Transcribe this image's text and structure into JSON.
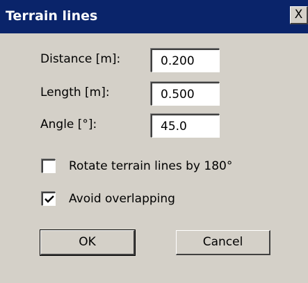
{
  "window": {
    "title": "Terrain lines",
    "close_glyph": "X"
  },
  "fields": {
    "distance": {
      "label": "Distance [m]:",
      "value": "0.200"
    },
    "length": {
      "label": "Length [m]:",
      "value": "0.500"
    },
    "angle": {
      "label": "Angle [°]:",
      "value": "45.0"
    }
  },
  "options": {
    "rotate": {
      "label": "Rotate terrain lines by 180°",
      "checked": false
    },
    "avoid_overlap": {
      "label": "Avoid overlapping",
      "checked": true
    }
  },
  "buttons": {
    "ok": "OK",
    "cancel": "Cancel"
  },
  "colors": {
    "titlebar": "#0a246a",
    "face": "#d4d0c8"
  }
}
